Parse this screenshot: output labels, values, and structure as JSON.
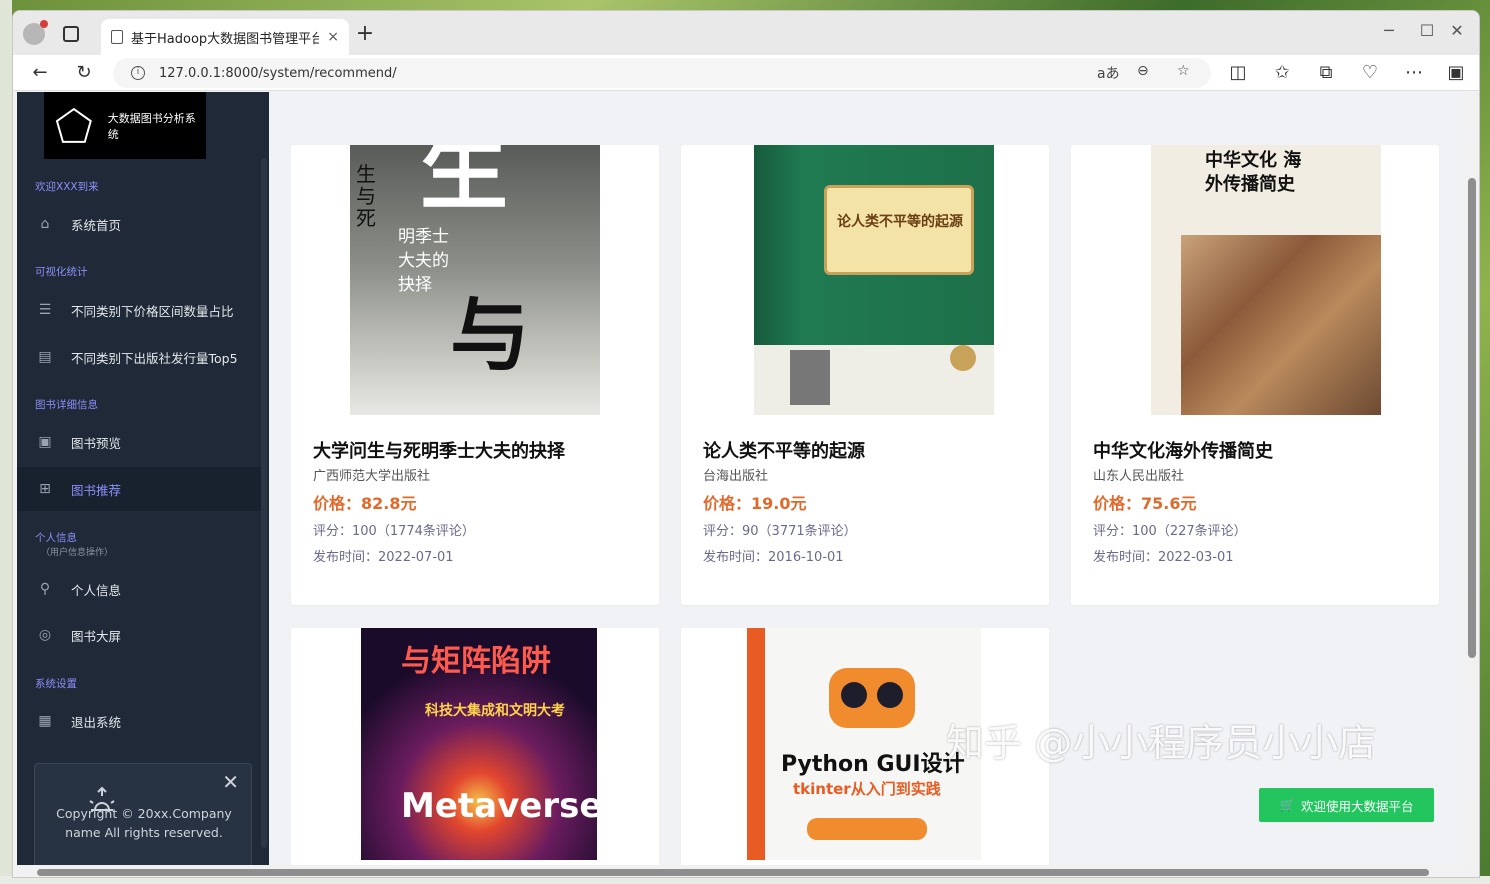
{
  "browser": {
    "tab_title": "基于Hadoop大数据图书管理平台",
    "url": "127.0.0.1:8000/system/recommend/",
    "tab_close": "×",
    "new_tab": "+"
  },
  "sidebar": {
    "brand": "大数据图书分析系统",
    "sections": {
      "welcome": "欢迎XXX到来",
      "viz": "可视化统计",
      "detail": "图书详细信息",
      "personal": "个人信息",
      "personal_sub": "（用户信息操作）",
      "settings": "系统设置"
    },
    "items": {
      "home": "系统首页",
      "price_ratio": "不同类别下价格区间数量占比",
      "publisher_top5": "不同类别下出版社发行量Top5",
      "book_preview": "图书预览",
      "book_recommend": "图书推荐",
      "profile": "个人信息",
      "big_screen": "图书大屏",
      "logout": "退出系统"
    },
    "promo": {
      "text": "Copyright © 20xx.Company name All rights reserved.",
      "close": "✕"
    }
  },
  "books": [
    {
      "title": "大学问生与死明季士大夫的抉择",
      "publisher": "广西师范大学出版社",
      "price": "价格：82.8元",
      "rating": "评分：100（1774条评论）",
      "date": "发布时间：2022-07-01",
      "cover_text": "生与死",
      "cover_sub": "明季士大夫的抉择"
    },
    {
      "title": "论人类不平等的起源",
      "publisher": "台海出版社",
      "price": "价格：19.0元",
      "rating": "评分：90（3771条评论）",
      "date": "发布时间：2016-10-01",
      "cover_text": "论人类不平等的起源"
    },
    {
      "title": "中华文化海外传播简史",
      "publisher": "山东人民出版社",
      "price": "价格：75.6元",
      "rating": "评分：100（227条评论）",
      "date": "发布时间：2022-03-01",
      "cover_text": "中华文化 海外传播简史"
    },
    {
      "cover_text": "与矩阵陷阱",
      "cover_sub": "科技大集成和文明大考",
      "cover_big": "Metaverse"
    },
    {
      "cover_text": "Python GUI设计",
      "cover_sub": "tkinter从入门到实践"
    }
  ],
  "float_button": "欢迎使用大数据平台",
  "watermark": "知乎 @小小程序员小小店",
  "colors": {
    "sidebar_bg": "#1f2937",
    "accent": "#8b8ff8",
    "price": "#e06a2b",
    "green": "#22c55e"
  }
}
